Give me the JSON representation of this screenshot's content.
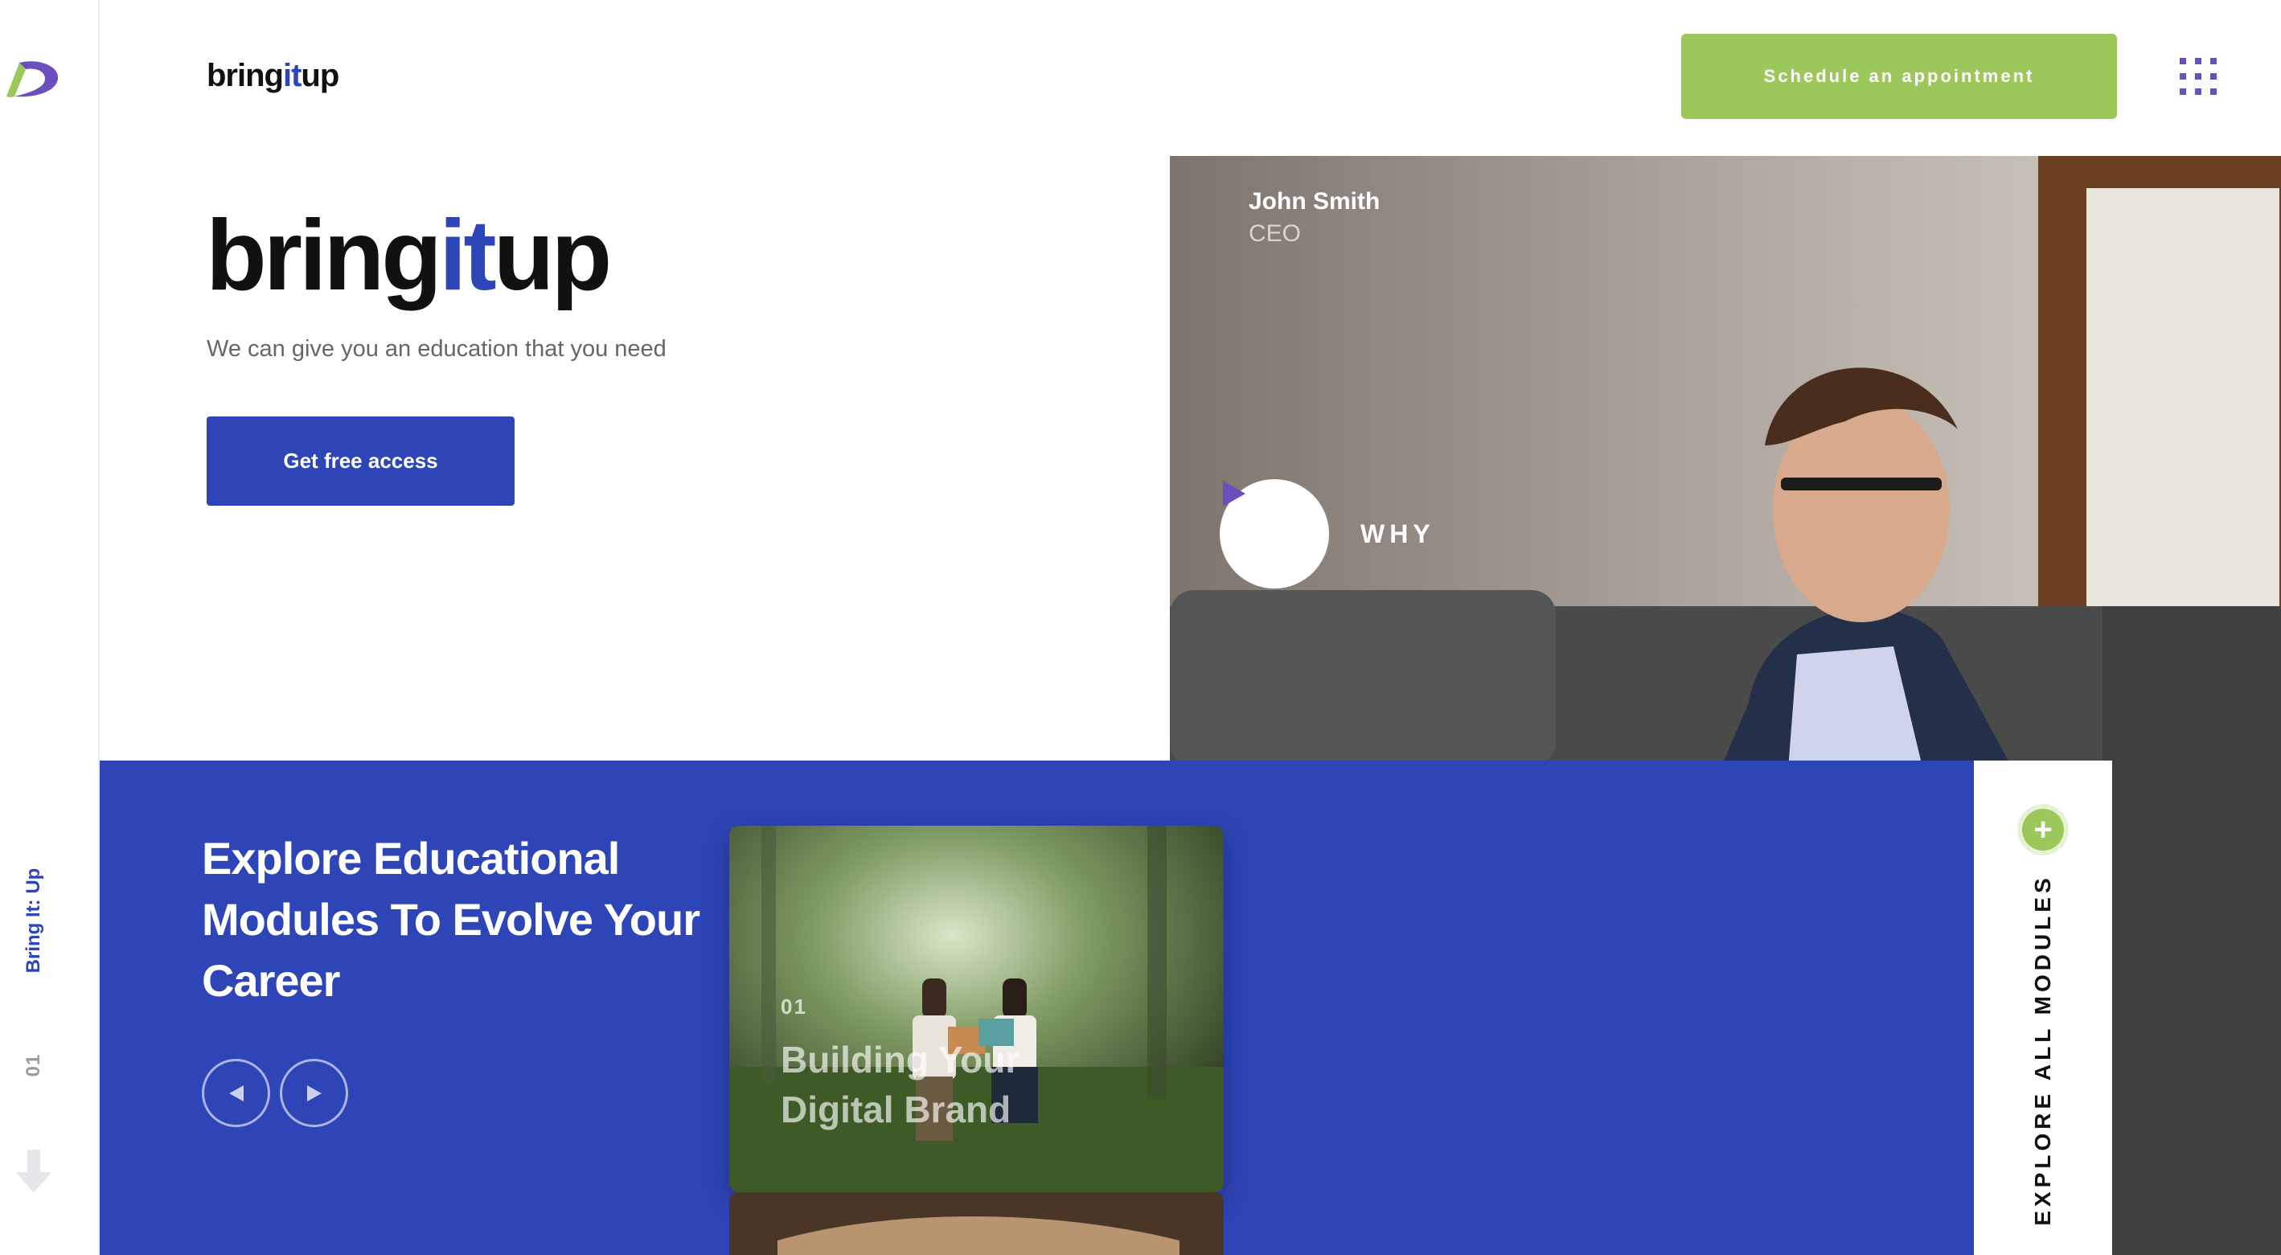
{
  "brand": {
    "logo_icon": "brand-swoosh-icon",
    "header_logo": {
      "part1": "bring",
      "part2": "it",
      "part3": "up"
    },
    "accent_color": "#2e45b8",
    "green_color": "#9cc75a",
    "purple_color": "#6b4fbf"
  },
  "rail": {
    "brand_label": "Bring It: Up",
    "slide_number": "01",
    "down_icon": "arrow-down-icon"
  },
  "header": {
    "schedule_label": "Schedule an appointment",
    "menu_icon": "grid-menu-icon"
  },
  "hero": {
    "title": {
      "part1": "bring",
      "part2": "it",
      "part3": "up"
    },
    "subtitle": "We can give you an education that you need",
    "cta_label": "Get free access"
  },
  "video": {
    "person_name": "John Smith",
    "person_role": "CEO",
    "play_icon": "play-icon",
    "label": "WHY"
  },
  "modules": {
    "title": "Explore Educational Modules To Evolve Your Career",
    "prev_icon": "arrow-left-icon",
    "next_icon": "arrow-right-icon",
    "cards": [
      {
        "number": "01",
        "title": "Building Your Digital Brand"
      }
    ],
    "explore_label": "EXPLORE ALL MODULES",
    "plus_icon": "plus-icon",
    "plus_symbol": "+"
  }
}
